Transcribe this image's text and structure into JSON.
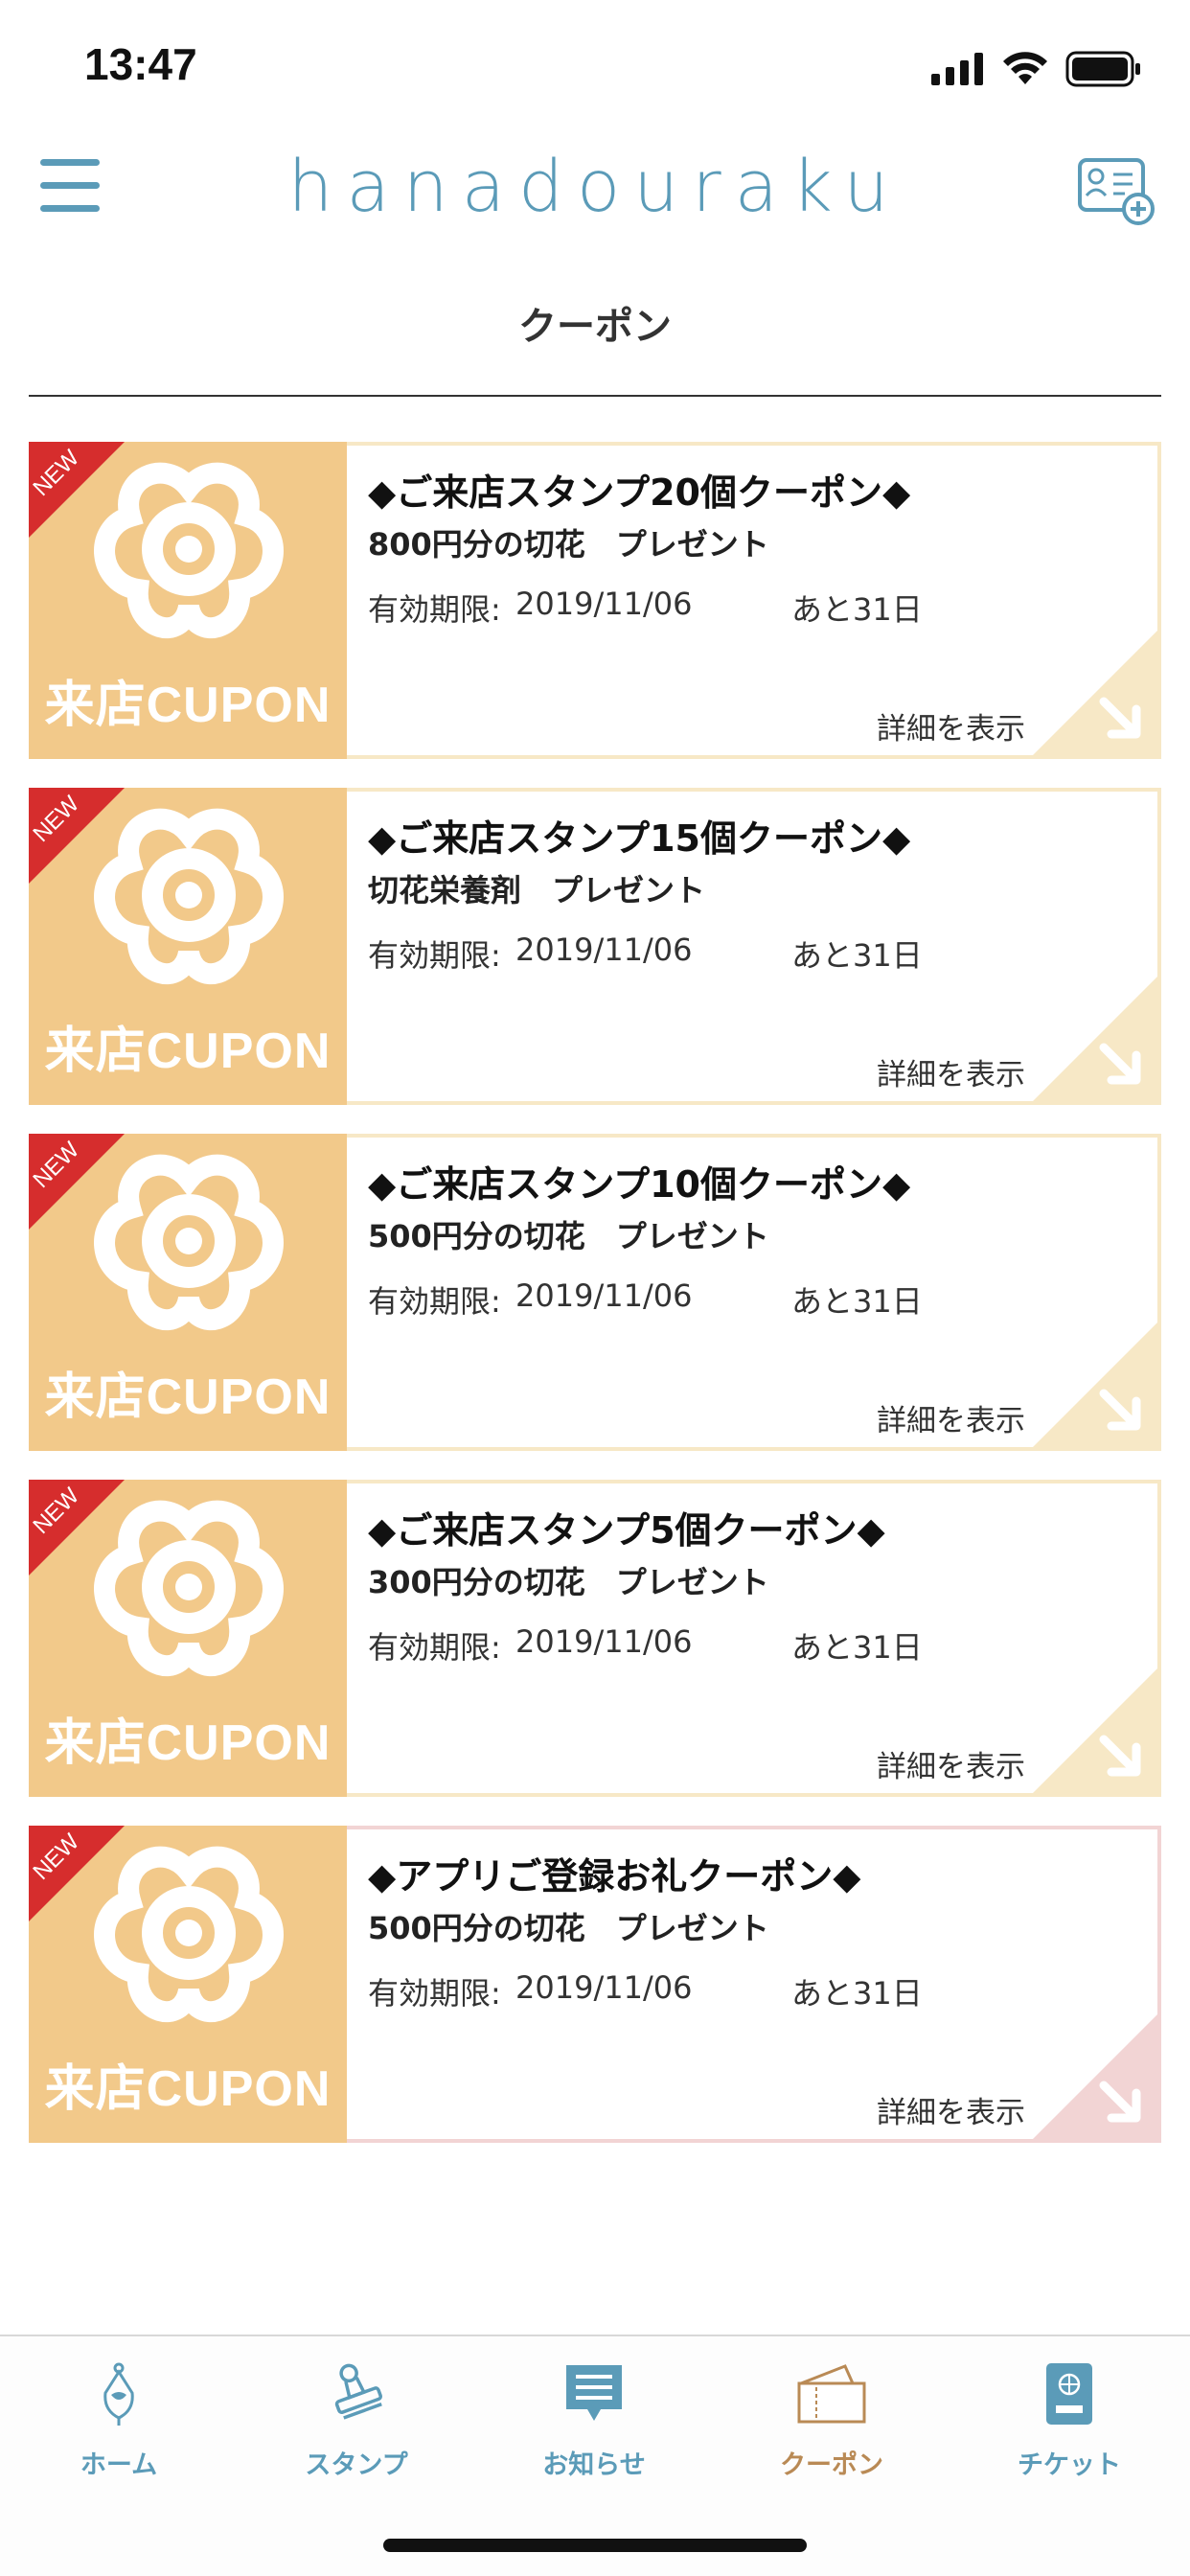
{
  "status": {
    "time": "13:47"
  },
  "header": {
    "logo": "hanadouraku",
    "page_title": "クーポン"
  },
  "colors": {
    "accent": "#5b9bb8",
    "coupon_image_bg": "#f2c98a",
    "new_ribbon": "#d62d2d",
    "active_tab": "#b98a55"
  },
  "coupons": [
    {
      "badge": "NEW",
      "image_text": "来店CUPON",
      "title": "◆ご来店スタンプ20個クーポン◆",
      "subtitle": "800円分の切花　プレゼント",
      "expiry_label": "有効期限:",
      "expiry_date": "2019/11/06",
      "remaining": "あと31日",
      "detail": "詳細を表示"
    },
    {
      "badge": "NEW",
      "image_text": "来店CUPON",
      "title": "◆ご来店スタンプ15個クーポン◆",
      "subtitle": "切花栄養剤　プレゼント",
      "expiry_label": "有効期限:",
      "expiry_date": "2019/11/06",
      "remaining": "あと31日",
      "detail": "詳細を表示"
    },
    {
      "badge": "NEW",
      "image_text": "来店CUPON",
      "title": "◆ご来店スタンプ10個クーポン◆",
      "subtitle": "500円分の切花　プレゼント",
      "expiry_label": "有効期限:",
      "expiry_date": "2019/11/06",
      "remaining": "あと31日",
      "detail": "詳細を表示"
    },
    {
      "badge": "NEW",
      "image_text": "来店CUPON",
      "title": "◆ご来店スタンプ5個クーポン◆",
      "subtitle": "300円分の切花　プレゼント",
      "expiry_label": "有効期限:",
      "expiry_date": "2019/11/06",
      "remaining": "あと31日",
      "detail": "詳細を表示"
    },
    {
      "badge": "NEW",
      "image_text": "来店CUPON",
      "title": "◆アプリご登録お礼クーポン◆",
      "subtitle": "500円分の切花　プレゼント",
      "expiry_label": "有効期限:",
      "expiry_date": "2019/11/06",
      "remaining": "あと31日",
      "detail": "詳細を表示"
    }
  ],
  "tabs": [
    {
      "label": "ホーム",
      "icon": "home-icon"
    },
    {
      "label": "スタンプ",
      "icon": "stamp-icon"
    },
    {
      "label": "お知らせ",
      "icon": "news-icon"
    },
    {
      "label": "クーポン",
      "icon": "coupon-icon",
      "active": true
    },
    {
      "label": "チケット",
      "icon": "ticket-icon"
    }
  ]
}
